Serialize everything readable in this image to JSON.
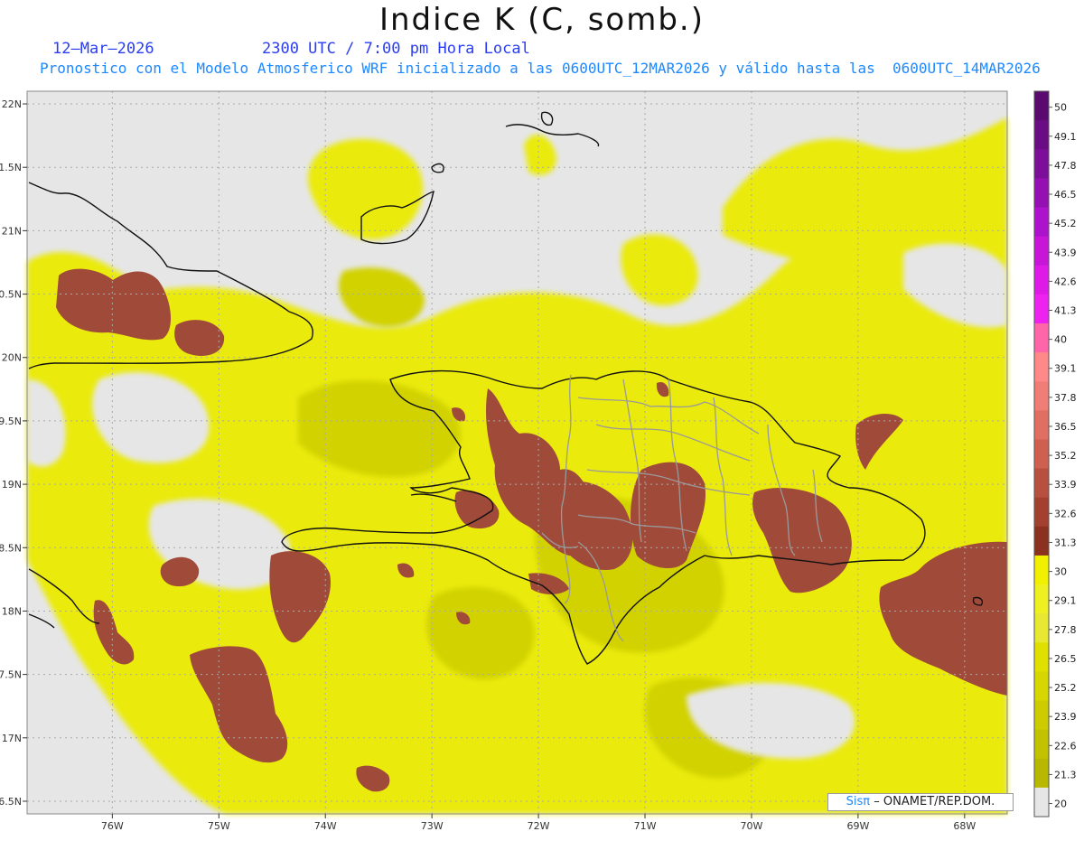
{
  "title": "Indice K (C, somb.)",
  "date_label": "12–Mar–2026",
  "time_label": "2300 UTC / 7:00 pm Hora Local",
  "description": "Pronostico con el Modelo Atmosferico WRF inicializado a las 0600UTC_12MAR2026 y válido hasta las  0600UTC_14MAR2026",
  "credit": {
    "brand": "Sisπ",
    "text": "– ONAMET/REP.DOM."
  },
  "map": {
    "lat_labels": [
      "22N",
      "1.5N",
      "21N",
      "0.5N",
      "20N",
      "9.5N",
      "19N",
      "8.5N",
      "18N",
      "7.5N",
      "17N",
      "6.5N"
    ],
    "lat_values": [
      22,
      21.5,
      21,
      20.5,
      20,
      19.5,
      19,
      18.5,
      18,
      17.5,
      17,
      16.5
    ],
    "lon_labels": [
      "76W",
      "75W",
      "74W",
      "73W",
      "72W",
      "71W",
      "70W",
      "69W",
      "68W"
    ],
    "lon_values": [
      -76,
      -75,
      -74,
      -73,
      -72,
      -71,
      -70,
      -69,
      -68
    ],
    "lon_range": [
      -76.8,
      -67.6
    ],
    "lat_range": [
      16.4,
      22.1
    ]
  },
  "legend": {
    "labels": [
      "50",
      "49.1",
      "47.8",
      "46.5",
      "45.2",
      "43.9",
      "42.6",
      "41.3",
      "40",
      "39.1",
      "37.8",
      "36.5",
      "35.2",
      "33.9",
      "32.6",
      "31.3",
      "30",
      "29.1",
      "27.8",
      "26.5",
      "25.2",
      "23.9",
      "22.6",
      "21.3",
      "20"
    ],
    "colors": [
      "#5a0a6e",
      "#6a0c84",
      "#7d0e99",
      "#9410b3",
      "#ad12cc",
      "#c816d9",
      "#de1be6",
      "#ee22ee",
      "#ff66aa",
      "#ff8888",
      "#f07e76",
      "#e06f62",
      "#cf604f",
      "#b8503f",
      "#a3402f",
      "#8c3020",
      "#f0f000",
      "#eef022",
      "#e6e832",
      "#e0e000",
      "#d6d600",
      "#cccc00",
      "#c2c200",
      "#b8b800",
      "#e6e6e6"
    ]
  }
}
